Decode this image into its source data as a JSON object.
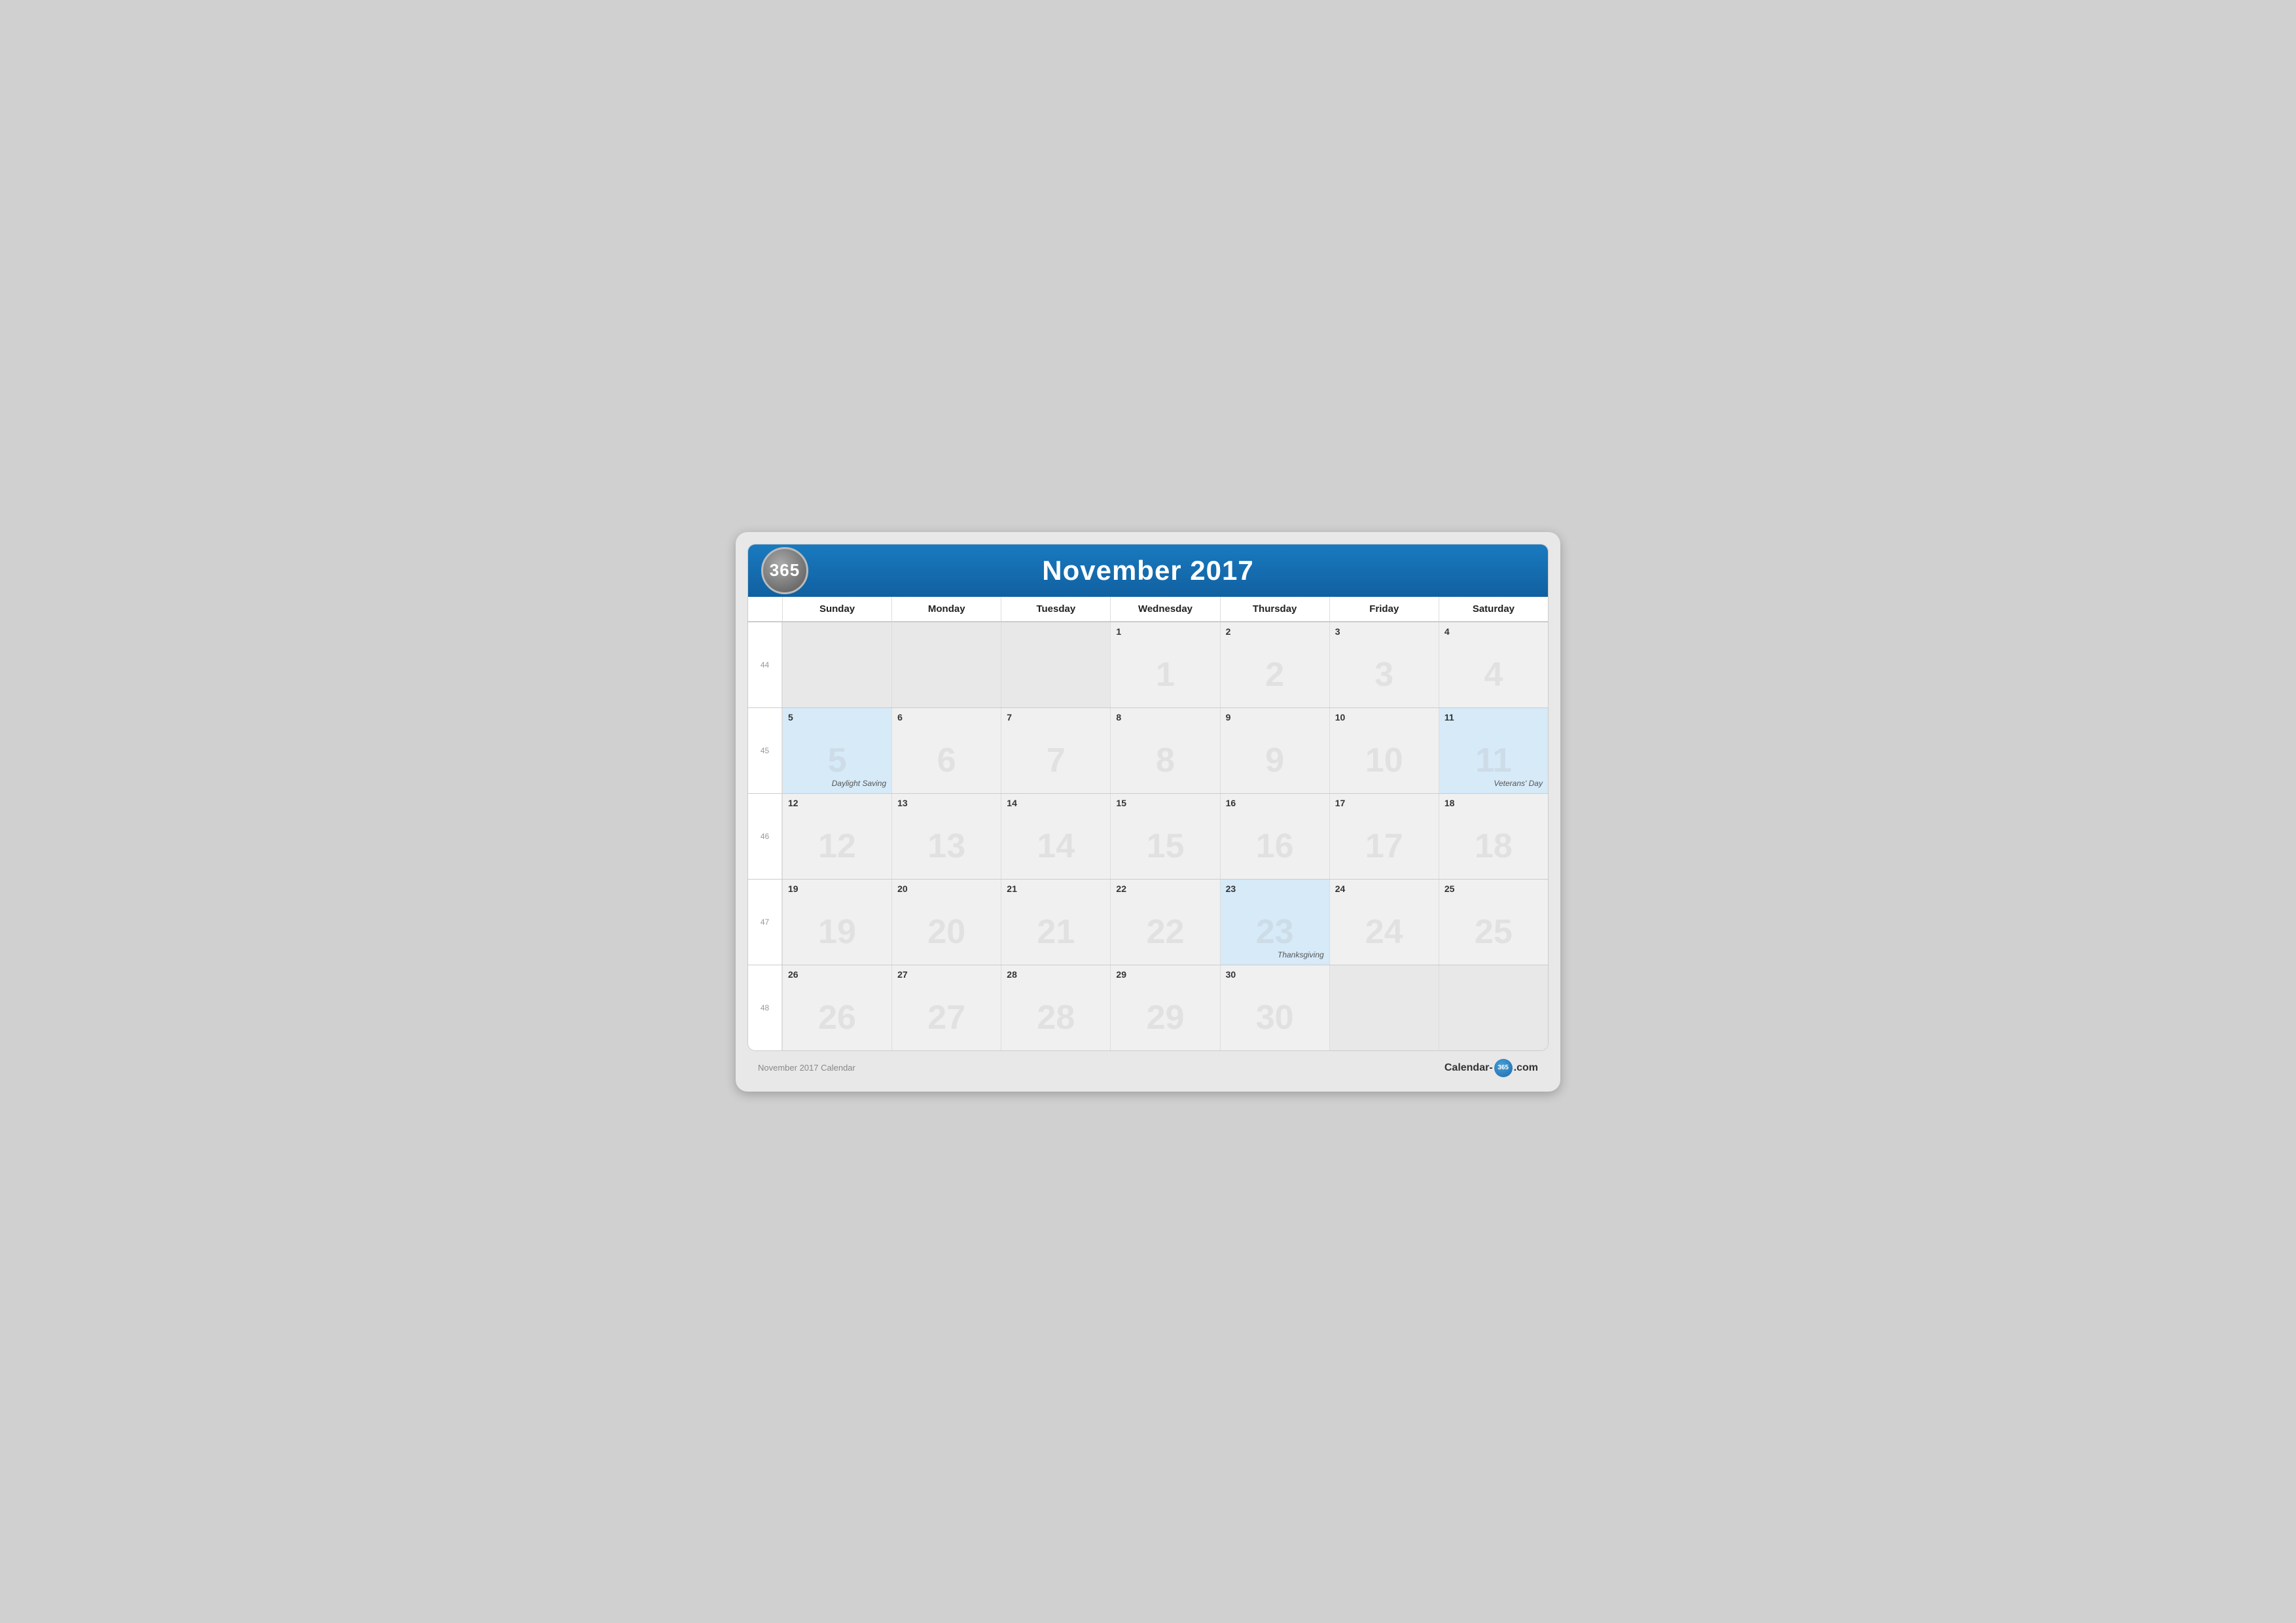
{
  "header": {
    "logo": "365",
    "title": "November 2017"
  },
  "days": [
    "Sunday",
    "Monday",
    "Tuesday",
    "Wednesday",
    "Thursday",
    "Friday",
    "Saturday"
  ],
  "weeks": [
    {
      "weekNum": "44",
      "days": [
        {
          "num": "",
          "empty": true
        },
        {
          "num": "",
          "empty": true
        },
        {
          "num": "",
          "empty": true
        },
        {
          "num": "1"
        },
        {
          "num": "2"
        },
        {
          "num": "3"
        },
        {
          "num": "4"
        }
      ]
    },
    {
      "weekNum": "45",
      "days": [
        {
          "num": "5",
          "highlight": true,
          "event": "Daylight Saving"
        },
        {
          "num": "6"
        },
        {
          "num": "7"
        },
        {
          "num": "8"
        },
        {
          "num": "9"
        },
        {
          "num": "10"
        },
        {
          "num": "11",
          "highlight": true,
          "event": "Veterans' Day"
        }
      ]
    },
    {
      "weekNum": "46",
      "days": [
        {
          "num": "12"
        },
        {
          "num": "13"
        },
        {
          "num": "14"
        },
        {
          "num": "15"
        },
        {
          "num": "16"
        },
        {
          "num": "17"
        },
        {
          "num": "18"
        }
      ]
    },
    {
      "weekNum": "47",
      "days": [
        {
          "num": "19"
        },
        {
          "num": "20"
        },
        {
          "num": "21"
        },
        {
          "num": "22"
        },
        {
          "num": "23",
          "highlight": true,
          "event": "Thanksgiving"
        },
        {
          "num": "24"
        },
        {
          "num": "25"
        }
      ]
    },
    {
      "weekNum": "48",
      "days": [
        {
          "num": "26"
        },
        {
          "num": "27"
        },
        {
          "num": "28"
        },
        {
          "num": "29"
        },
        {
          "num": "30"
        },
        {
          "num": "",
          "inactive": true
        },
        {
          "num": "",
          "inactive": true
        }
      ]
    }
  ],
  "footer": {
    "left": "November 2017 Calendar",
    "right_prefix": "Calendar-",
    "right_circle": "365",
    "right_suffix": ".com"
  }
}
